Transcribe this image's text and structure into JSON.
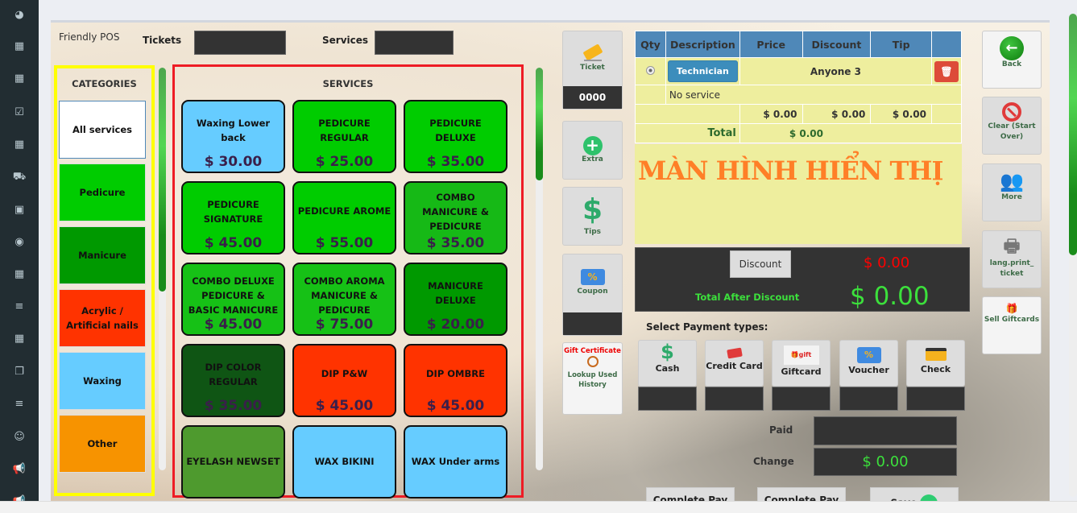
{
  "sidebar": {
    "icons": [
      "dashboard-icon",
      "calendar-icon",
      "calendar-icon",
      "calendar-check-icon",
      "calendar-icon",
      "cart-icon",
      "briefcase-icon",
      "eye-icon",
      "calendar-icon",
      "menu-icon",
      "calendar-icon",
      "copy-icon",
      "menu-icon",
      "smile-icon",
      "bullhorn-icon",
      "bullhorn-icon"
    ]
  },
  "header": {
    "brand": "Friendly POS",
    "tickets_label": "Tickets",
    "services_label": "Services"
  },
  "categories": {
    "title": "CATEGORIES",
    "items": [
      {
        "label": "All services",
        "color": "#ffffff"
      },
      {
        "label": "Pedicure",
        "color": "#00cc00"
      },
      {
        "label": "Manicure",
        "color": "#009900"
      },
      {
        "label": "Acrylic / Artificial nails",
        "color": "#ff3300"
      },
      {
        "label": "Waxing",
        "color": "#66ccff"
      },
      {
        "label": "Other",
        "color": "#f79300"
      }
    ]
  },
  "services": {
    "title": "SERVICES",
    "items": [
      {
        "name": "Waxing Lower back",
        "price": "$ 30.00",
        "color": "#66ccff"
      },
      {
        "name": "PEDICURE REGULAR",
        "price": "$ 25.00",
        "color": "#00cc00"
      },
      {
        "name": "PEDICURE DELUXE",
        "price": "$ 35.00",
        "color": "#00cc00"
      },
      {
        "name": "PEDICURE SIGNATURE",
        "price": "$ 45.00",
        "color": "#00cc00"
      },
      {
        "name": "PEDICURE AROME",
        "price": "$ 55.00",
        "color": "#00cc00"
      },
      {
        "name": "COMBO MANICURE & PEDICURE",
        "price": "$ 35.00",
        "color": "#16b916"
      },
      {
        "name": "COMBO DELUXE PEDICURE & BASIC MANICURE",
        "price": "$ 45.00",
        "color": "#16c116"
      },
      {
        "name": "COMBO AROMA MANICURE & PEDICURE",
        "price": "$ 75.00",
        "color": "#16c116"
      },
      {
        "name": "MANICURE DELUXE",
        "price": "$ 20.00",
        "color": "#009900"
      },
      {
        "name": "DIP COLOR REGULAR",
        "price": "$ 35.00",
        "color": "#0f5514"
      },
      {
        "name": "DIP P&W",
        "price": "$ 45.00",
        "color": "#ff3300"
      },
      {
        "name": "DIP OMBRE",
        "price": "$ 45.00",
        "color": "#ff3300"
      },
      {
        "name": "EYELASH NEWSET",
        "price": "",
        "color": "#4e9a2e"
      },
      {
        "name": "WAX BIKINI",
        "price": "",
        "color": "#66ccff"
      },
      {
        "name": "WAX Under arms",
        "price": "",
        "color": "#66ccff"
      }
    ]
  },
  "tools": {
    "ticket_label": "Ticket",
    "ticket_number": "0000",
    "extra_label": "Extra",
    "tips_label": "Tips",
    "coupon_label": "Coupon",
    "gift_cert_label": "Gift Certificate",
    "lookup_label": "Lookup Used History"
  },
  "order": {
    "columns": [
      "Qty",
      "Description",
      "Price",
      "Discount",
      "Tip",
      ""
    ],
    "technician_button": "Technician",
    "technician_name": "Anyone 3",
    "no_service": "No service",
    "price_sum": "$ 0.00",
    "discount_sum": "$ 0.00",
    "tip_sum": "$ 0.00",
    "total_label": "Total",
    "total_value": "$ 0.00"
  },
  "display": {
    "banner": "MÀN HÌNH HIỂN THỊ"
  },
  "discount_panel": {
    "discount_button": "Discount",
    "discount_value": "$ 0.00",
    "total_after_label": "Total After Discount",
    "total_after_value": "$ 0.00"
  },
  "payment": {
    "title": "Select Payment types:",
    "types": [
      {
        "label": "Cash",
        "icon": "dollar-icon"
      },
      {
        "label": "Credit Card",
        "icon": "credit-card-icon"
      },
      {
        "label": "Giftcard",
        "icon": "giftcard-icon"
      },
      {
        "label": "Voucher",
        "icon": "voucher-icon"
      },
      {
        "label": "Check",
        "icon": "check-card-icon"
      }
    ],
    "paid_label": "Paid",
    "change_label": "Change",
    "change_value": "$ 0.00"
  },
  "actions": {
    "complete_pay_1": "Complete Pay",
    "complete_pay_2": "Complete Pay",
    "save": "Save"
  },
  "right_panel": {
    "back": "Back",
    "clear": "Clear (Start Over)",
    "more": "More",
    "print": "lang.print_ ticket",
    "sell_giftcards": "Sell Giftcards"
  }
}
